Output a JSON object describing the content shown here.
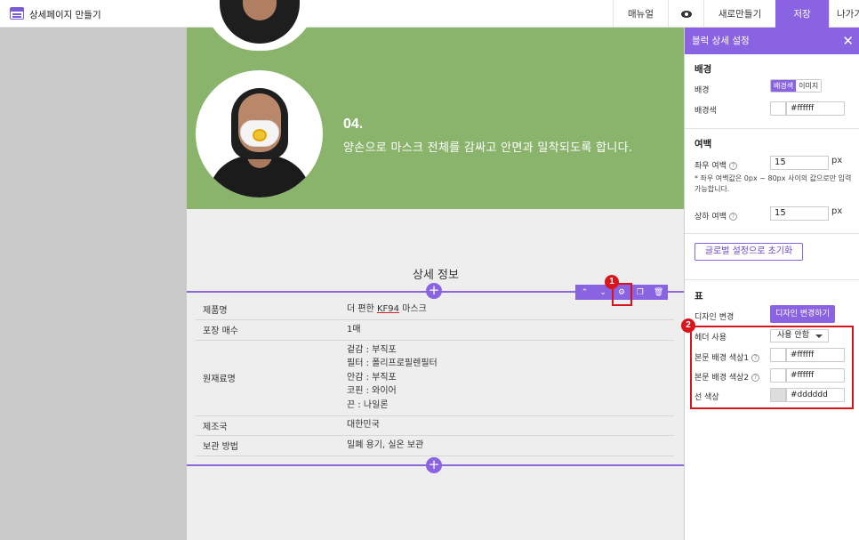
{
  "app": {
    "title": "상세페이지 만들기"
  },
  "topbar": {
    "manual": "매뉴얼",
    "new": "새로만들기",
    "save": "저장",
    "exit": "나가기"
  },
  "canvas": {
    "step_num": "04.",
    "step_text": "양손으로 마스크 전체를 감싸고 안면과 밀착되도록 합니다.",
    "detail_title": "상세 정보",
    "plus": "+",
    "table": {
      "r0": {
        "k": "제품명",
        "v_pre": "더 편한 ",
        "v_kf": "KF94",
        "v_post": " 마스크"
      },
      "r1": {
        "k": "포장 매수",
        "v": "1매"
      },
      "r2": {
        "k": "원재료명",
        "l1": "겉감 : 부직포",
        "l2": "필터 : 폴리프로필렌필터",
        "l3": "안감 : 부직포",
        "l4": "코핀 : 와이어",
        "l5": "끈 : 나일론"
      },
      "r3": {
        "k": "제조국",
        "v": "대한민국"
      },
      "r4": {
        "k": "보관 방법",
        "v": "밀폐 용기, 실온 보관"
      }
    },
    "toolbar_icons": [
      "chevron-up-icon",
      "chevron-down-icon",
      "gear-icon",
      "copy-icon",
      "trash-icon"
    ]
  },
  "badges": {
    "one": "1",
    "two": "2"
  },
  "panel": {
    "title": "블럭 상세 설정",
    "close": "✕",
    "bg_section": "배경",
    "bg_label": "배경",
    "bg_color_opt": "배경색",
    "bg_image_opt": "이미지",
    "bg_color_label": "배경색",
    "bg_color_value": "#ffffff",
    "margin_section": "여백",
    "lr_label": "좌우 여백",
    "lr_value": "15",
    "unit": "px",
    "note": "* 좌우 여백값은 0px ~ 80px 사이의 값으로만 입력 가능합니다.",
    "tb_label": "상하 여백",
    "tb_value": "15",
    "reset_btn": "글로벌 설정으로 초기화",
    "table_section": "표",
    "design_label": "디자인 변경",
    "design_btn": "디자인 변경하기",
    "header_label": "헤더 사용",
    "header_value": "사용 안함",
    "body1_label": "본문 배경 색상1",
    "body1_value": "#ffffff",
    "body2_label": "본문 배경 색상2",
    "body2_value": "#ffffff",
    "line_label": "선 색상",
    "line_value": "#dddddd",
    "line_swatch_color": "#dddddd"
  }
}
